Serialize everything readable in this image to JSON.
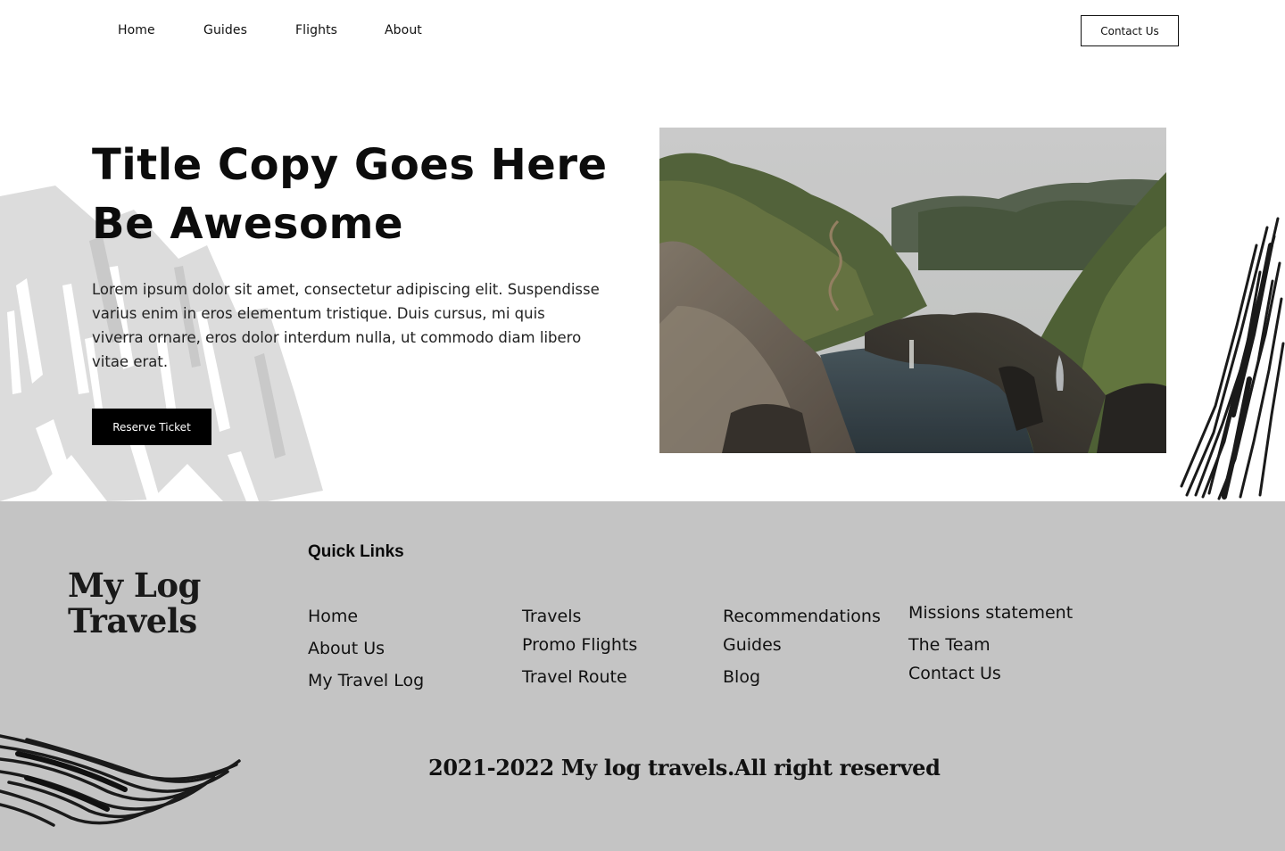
{
  "nav": {
    "links": [
      "Home",
      "Guides",
      "Flights",
      "About"
    ],
    "contact_label": "Contact Us"
  },
  "hero": {
    "title_line1": "Title Copy Goes Here",
    "title_line2": "Be Awesome",
    "body": "Lorem ipsum dolor sit amet, consectetur adipiscing elit. Suspendisse varius enim in eros elementum tristique. Duis cursus, mi quis viverra ornare, eros dolor interdum nulla, ut commodo diam libero vitae erat.",
    "cta_label": "Reserve Ticket"
  },
  "footer": {
    "logo_line1": "My Log",
    "logo_line2": "Travels",
    "quick_links_title": "Quick Links",
    "columns": [
      [
        "Home",
        "About Us",
        "My Travel Log"
      ],
      [
        "Travels",
        "Promo Flights",
        "Travel Route"
      ],
      [
        "Recommendations",
        "Guides",
        "Blog"
      ],
      [
        "Missions statement",
        "The Team",
        "Contact Us"
      ]
    ],
    "copyright": "2021-2022 My log travels.All right reserved"
  },
  "colors": {
    "footer_bg": "#c4c4c4",
    "button_bg": "#000000",
    "text": "#111111"
  }
}
